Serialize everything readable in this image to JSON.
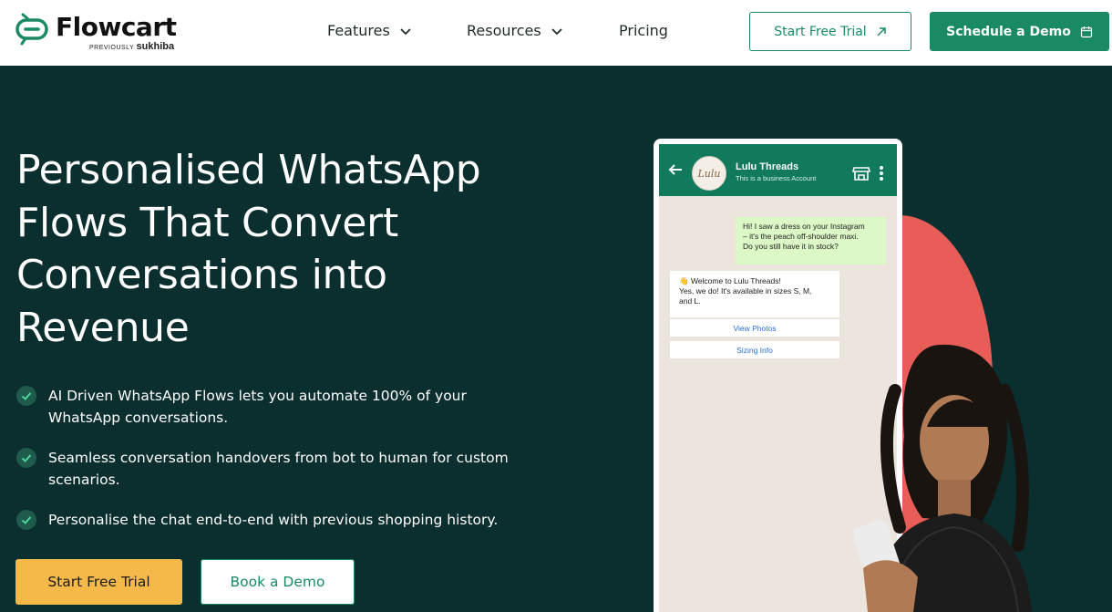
{
  "brand": {
    "name": "Flowcart",
    "previously_label": "PREVIOUSLY",
    "previously_name": "sukhiba"
  },
  "nav": {
    "features": "Features",
    "resources": "Resources",
    "pricing": "Pricing",
    "trial_button": "Start Free Trial",
    "demo_button": "Schedule a Demo"
  },
  "hero": {
    "headline_lines": [
      "Personalised WhatsApp",
      "Flows That Convert",
      "Conversations into",
      "Revenue"
    ],
    "bullets": [
      {
        "line1": "AI Driven WhatsApp Flows lets you automate 100% of your",
        "line2": "WhatsApp conversations."
      },
      {
        "line1": "Seamless conversation handovers from bot to human for custom",
        "line2": "scenarios."
      },
      {
        "line1": "Personalise the chat end-to-end with previous shopping history.",
        "line2": ""
      }
    ],
    "cta_primary": "Start Free Trial",
    "cta_secondary": "Book a Demo"
  },
  "chat": {
    "contact_name": "Lulu Threads",
    "contact_subtitle": "This is a business Account",
    "avatar_text": "Lulu",
    "outgoing": [
      "Hi! I saw a dress on your Instagram",
      "– it's the peach off-shoulder maxi.",
      "Do you still have it in stock?"
    ],
    "incoming": [
      "👋  Welcome to Lulu Threads!",
      "Yes, we do! It's available in sizes S, M,",
      "and L."
    ],
    "quick_replies": [
      "View Photos",
      "Sizing Info"
    ]
  },
  "colors": {
    "accent_green": "#1a8a64",
    "hero_bg": "#0b2f2e",
    "cta_yellow": "#f5b94a",
    "whatsapp_header": "#117a5c",
    "coral": "#e85d57"
  }
}
